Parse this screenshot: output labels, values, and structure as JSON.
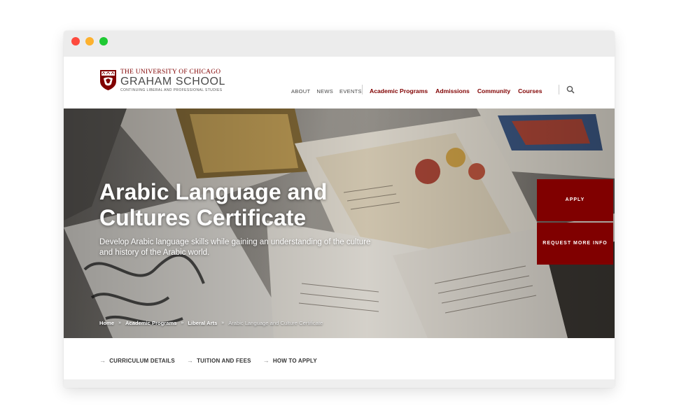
{
  "header": {
    "logo": {
      "university": "THE UNIVERSITY OF CHICAGO",
      "school": "GRAHAM SCHOOL",
      "tagline": "CONTINUING LIBERAL AND PROFESSIONAL STUDIES",
      "icon": "university-shield-icon"
    },
    "utility_nav": [
      "ABOUT",
      "NEWS",
      "EVENTS"
    ],
    "main_nav": [
      "Academic Programs",
      "Admissions",
      "Community",
      "Courses"
    ],
    "search_icon": "search-icon"
  },
  "hero": {
    "title": "Arabic Language and Cultures Certificate",
    "subtitle": "Develop Arabic language skills while gaining an understanding of the culture and history of the Arabic world.",
    "apply_label": "APPLY",
    "request_info_label": "REQUEST MORE INFO",
    "breadcrumb": [
      "Home",
      "Academic Programs",
      "Liberal Arts",
      "Arabic Language and Culture Certificate"
    ]
  },
  "subnav": [
    "CURRICULUM DETAILS",
    "TUITION AND FEES",
    "HOW TO APPLY"
  ],
  "colors": {
    "brand": "#800000",
    "hero_text": "#ffffff"
  }
}
